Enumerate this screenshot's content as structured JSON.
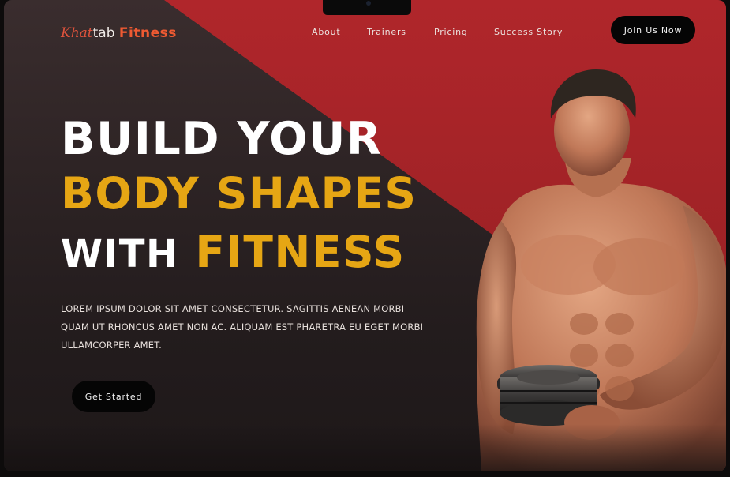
{
  "brand": {
    "logo_part1": "Khat",
    "logo_part2": "tab",
    "logo_part3": "Fitness"
  },
  "nav": {
    "items": [
      {
        "label": "About"
      },
      {
        "label": "Trainers"
      },
      {
        "label": "Pricing"
      },
      {
        "label": "Success Story"
      }
    ],
    "cta": "Join Us Now"
  },
  "hero": {
    "line1": "BUILD YOUR",
    "line2": "BODY SHAPES",
    "line3_white": "WITH",
    "line3_gold": "FITNESS",
    "description_lines": [
      "LOREM IPSUM DOLOR SIT AMET CONSECTETUR. SAGITTIS AENEAN MORBI",
      "QUAM UT RHONCUS AMET NON AC. ALIQUAM EST PHARETRA EU EGET MORBI",
      "ULLAMCORPER AMET."
    ],
    "cta": "Get Started"
  },
  "colors": {
    "accent_red": "#a32327",
    "accent_gold": "#e6a614",
    "logo_orange": "#ef5a32",
    "dark_bg": "#2a2122"
  }
}
